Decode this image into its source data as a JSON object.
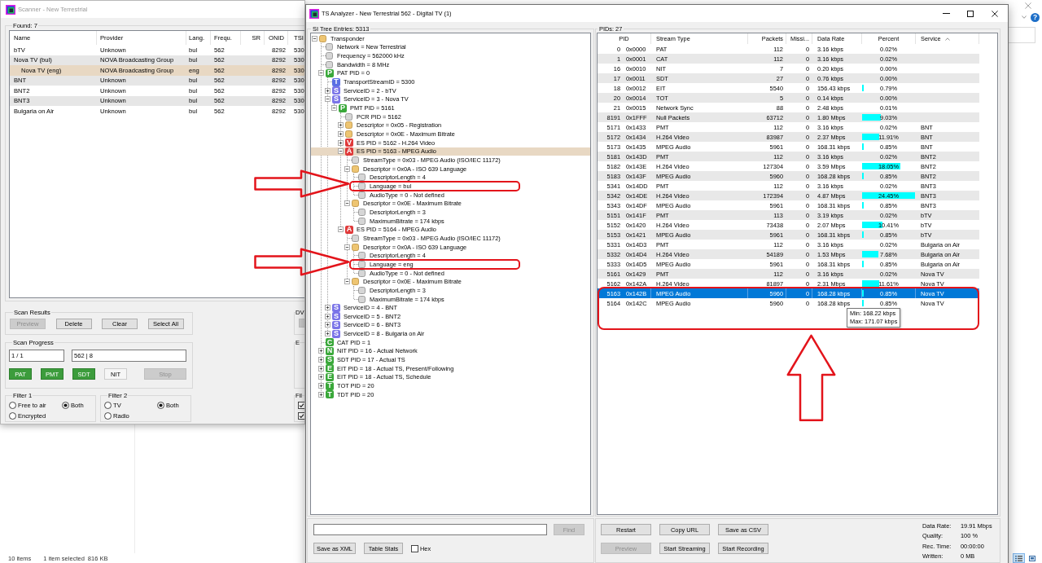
{
  "scanner": {
    "title": "Scanner - New Terrestrial",
    "list": {
      "label": "Found: 7",
      "columns": [
        "Name",
        "Provider",
        "Lang.",
        "Frequ.",
        "SR",
        "ONID",
        "TSI"
      ],
      "rows": [
        {
          "name": "bTV",
          "provider": "Unknown",
          "lang": "bul",
          "frequ": "562",
          "onid": "8292",
          "tsi": "530",
          "selected": false
        },
        {
          "name": "Nova TV (bul)",
          "provider": "NOVA Broadcasting Group",
          "lang": "bul",
          "frequ": "562",
          "onid": "8292",
          "tsi": "530",
          "selected": false,
          "children": [
            {
              "name": "Nova TV (eng)",
              "provider": "NOVA Broadcasting Group",
              "lang": "eng",
              "frequ": "562",
              "onid": "8292",
              "tsi": "530",
              "selected": true
            }
          ]
        },
        {
          "name": "BNT",
          "provider": "Unknown",
          "lang": "bul",
          "frequ": "562",
          "onid": "8292",
          "tsi": "530",
          "selected": false
        },
        {
          "name": "BNT2",
          "provider": "Unknown",
          "lang": "bul",
          "frequ": "562",
          "onid": "8292",
          "tsi": "530",
          "selected": false
        },
        {
          "name": "BNT3",
          "provider": "Unknown",
          "lang": "bul",
          "frequ": "562",
          "onid": "8292",
          "tsi": "530",
          "selected": false
        },
        {
          "name": "Bulgaria on Air",
          "provider": "Unknown",
          "lang": "bul",
          "frequ": "562",
          "onid": "8292",
          "tsi": "530",
          "selected": false
        }
      ]
    },
    "scan_results": {
      "title": "Scan Results",
      "buttons": [
        {
          "label": "Preview",
          "disabled": true
        },
        {
          "label": "Delete",
          "disabled": false
        },
        {
          "label": "Clear",
          "disabled": false
        },
        {
          "label": "Select All",
          "disabled": false
        }
      ]
    },
    "scan_progress": {
      "title": "Scan Progress",
      "fields": [
        "1 / 1",
        "562 | 8"
      ],
      "tables": [
        {
          "label": "PAT",
          "on": true
        },
        {
          "label": "PMT",
          "on": true
        },
        {
          "label": "SDT",
          "on": true
        },
        {
          "label": "NIT",
          "on": false
        }
      ],
      "stop": {
        "label": "Stop",
        "disabled": true
      }
    },
    "filters": [
      {
        "title": "Filter 1",
        "options": [
          {
            "label": "Free to air",
            "selected": false
          },
          {
            "label": "Both",
            "selected": true
          },
          {
            "label": "Encrypted",
            "selected": false
          }
        ]
      },
      {
        "title": "Filter 2",
        "options": [
          {
            "label": "TV",
            "selected": false
          },
          {
            "label": "Both",
            "selected": true
          },
          {
            "label": "Radio",
            "selected": false
          }
        ]
      }
    ],
    "side_groups": [
      {
        "title": "DV",
        "buttons": [
          {
            "disabled": true
          }
        ]
      },
      {
        "title": "E"
      },
      {
        "title": "Fil",
        "checkboxes": [
          {
            "checked": true
          },
          {
            "checked": true
          }
        ]
      }
    ]
  },
  "analyzer": {
    "title": "TS Analyzer - New Terrestrial 562 - Digital TV (1)",
    "tree": {
      "label": "SI Tree Entries: 5313",
      "nodes": [
        {
          "text": "Transponder",
          "kind": "folder",
          "expanded": true,
          "selected": false,
          "children": [
            {
              "text": "Network = New Terrestrial",
              "kind": "item",
              "selected": false
            },
            {
              "text": "Frequency = 562000 kHz",
              "kind": "item",
              "selected": false
            },
            {
              "text": "Bandwidth = 8 MHz",
              "kind": "item",
              "selected": false
            },
            {
              "text": "PAT PID = 0",
              "kind": "tag",
              "badge": "P",
              "color": "#3aa83a",
              "expanded": true,
              "selected": false,
              "children": [
                {
                  "text": "TransportStreamID = 5300",
                  "kind": "tag",
                  "badge": "T",
                  "color": "#5b6fe3",
                  "selected": false
                },
                {
                  "text": "ServiceID = 2 - bTV",
                  "kind": "tag",
                  "badge": "S",
                  "color": "#7a74e8",
                  "expanded": false,
                  "selected": false
                },
                {
                  "text": "ServiceID = 3 - Nova TV",
                  "kind": "tag",
                  "badge": "S",
                  "color": "#7a74e8",
                  "expanded": true,
                  "selected": false,
                  "children": [
                    {
                      "text": "PMT PID = 5161",
                      "kind": "tag",
                      "badge": "P",
                      "color": "#3aa83a",
                      "expanded": true,
                      "selected": false,
                      "children": [
                        {
                          "text": "PCR PID = 5162",
                          "kind": "item",
                          "selected": false
                        },
                        {
                          "text": "Descriptor = 0x05 - Registration",
                          "kind": "folder",
                          "expanded": false,
                          "selected": false
                        },
                        {
                          "text": "Descriptor = 0x0E - Maximum Bitrate",
                          "kind": "folder",
                          "expanded": false,
                          "selected": false
                        },
                        {
                          "text": "ES PID = 5162 - H.264 Video",
                          "kind": "tag",
                          "badge": "V",
                          "color": "#e03a3a",
                          "expanded": false,
                          "selected": false
                        },
                        {
                          "text": "ES PID = 5163 - MPEG Audio",
                          "kind": "tag",
                          "badge": "A",
                          "color": "#e03a3a",
                          "expanded": true,
                          "selected": true,
                          "children": [
                            {
                              "text": "StreamType = 0x03 - MPEG Audio (ISO/IEC 11172)",
                              "kind": "item",
                              "selected": false
                            },
                            {
                              "text": "Descriptor = 0x0A - ISO 639 Language",
                              "kind": "folder",
                              "expanded": true,
                              "selected": false,
                              "children": [
                                {
                                  "text": "DescriptorLength = 4",
                                  "kind": "item",
                                  "selected": false
                                },
                                {
                                  "text": "Language = bul",
                                  "kind": "item",
                                  "selected": false,
                                  "annotated": true
                                },
                                {
                                  "text": "AudioType = 0 - Not defined",
                                  "kind": "item",
                                  "selected": false
                                }
                              ]
                            },
                            {
                              "text": "Descriptor = 0x0E - Maximum Bitrate",
                              "kind": "folder",
                              "expanded": true,
                              "selected": false,
                              "children": [
                                {
                                  "text": "DescriptorLength = 3",
                                  "kind": "item",
                                  "selected": false
                                },
                                {
                                  "text": "MaximumBitrate = 174 kbps",
                                  "kind": "item",
                                  "selected": false
                                }
                              ]
                            }
                          ]
                        },
                        {
                          "text": "ES PID = 5164 - MPEG Audio",
                          "kind": "tag",
                          "badge": "A",
                          "color": "#e03a3a",
                          "expanded": true,
                          "selected": false,
                          "children": [
                            {
                              "text": "StreamType = 0x03 - MPEG Audio (ISO/IEC 11172)",
                              "kind": "item",
                              "selected": false
                            },
                            {
                              "text": "Descriptor = 0x0A - ISO 639 Language",
                              "kind": "folder",
                              "expanded": true,
                              "selected": false,
                              "children": [
                                {
                                  "text": "DescriptorLength = 4",
                                  "kind": "item",
                                  "selected": false
                                },
                                {
                                  "text": "Language = eng",
                                  "kind": "item",
                                  "selected": false,
                                  "annotated": true
                                },
                                {
                                  "text": "AudioType = 0 - Not defined",
                                  "kind": "item",
                                  "selected": false
                                }
                              ]
                            },
                            {
                              "text": "Descriptor = 0x0E - Maximum Bitrate",
                              "kind": "folder",
                              "expanded": true,
                              "selected": false,
                              "children": [
                                {
                                  "text": "DescriptorLength = 3",
                                  "kind": "item",
                                  "selected": false
                                },
                                {
                                  "text": "MaximumBitrate = 174 kbps",
                                  "kind": "item",
                                  "selected": false
                                }
                              ]
                            }
                          ]
                        }
                      ]
                    }
                  ]
                },
                {
                  "text": "ServiceID = 4 - BNT",
                  "kind": "tag",
                  "badge": "S",
                  "color": "#7a74e8",
                  "expanded": false,
                  "selected": false
                },
                {
                  "text": "ServiceID = 5 - BNT2",
                  "kind": "tag",
                  "badge": "S",
                  "color": "#7a74e8",
                  "expanded": false,
                  "selected": false
                },
                {
                  "text": "ServiceID = 6 - BNT3",
                  "kind": "tag",
                  "badge": "S",
                  "color": "#7a74e8",
                  "expanded": false,
                  "selected": false
                },
                {
                  "text": "ServiceID = 8 - Bulgaria on Air",
                  "kind": "tag",
                  "badge": "S",
                  "color": "#7a74e8",
                  "expanded": false,
                  "selected": false
                }
              ]
            },
            {
              "text": "CAT PID = 1",
              "kind": "tag",
              "badge": "C",
              "color": "#3aa83a",
              "selected": false
            },
            {
              "text": "NIT PID = 16 - Actual Network",
              "kind": "tag",
              "badge": "N",
              "color": "#3aa83a",
              "expanded": false,
              "selected": false
            },
            {
              "text": "SDT PID = 17 - Actual TS",
              "kind": "tag",
              "badge": "S",
              "color": "#3aa83a",
              "expanded": false,
              "selected": false
            },
            {
              "text": "EIT PID = 18 - Actual TS, Present/Following",
              "kind": "tag",
              "badge": "E",
              "color": "#3aa83a",
              "expanded": false,
              "selected": false
            },
            {
              "text": "EIT PID = 18 - Actual TS, Schedule",
              "kind": "tag",
              "badge": "E",
              "color": "#3aa83a",
              "expanded": false,
              "selected": false
            },
            {
              "text": "TOT PID = 20",
              "kind": "tag",
              "badge": "T",
              "color": "#3aa83a",
              "expanded": false,
              "selected": false
            },
            {
              "text": "TDT PID = 20",
              "kind": "tag",
              "badge": "T",
              "color": "#3aa83a",
              "expanded": false,
              "selected": false
            }
          ]
        }
      ]
    },
    "find": {
      "label": "Find",
      "disabled": true
    },
    "tree_buttons": [
      {
        "label": "Save as XML",
        "disabled": false
      },
      {
        "label": "Table Stats",
        "disabled": false
      }
    ],
    "hex": {
      "label": "Hex",
      "checked": false
    },
    "pid_table": {
      "label": "PIDs: 27",
      "columns": [
        {
          "label": "PID"
        },
        {
          "label": "Stream Type"
        },
        {
          "label": "Packets"
        },
        {
          "label": "Missi..."
        },
        {
          "label": "Data Rate"
        },
        {
          "label": "Percent"
        },
        {
          "label": "Service",
          "sorted": true
        }
      ],
      "rows": [
        {
          "pid": "0",
          "hex": "0x0000",
          "type": "PAT",
          "packets": "112",
          "missing": "0",
          "rate": "3.16 kbps",
          "percent": "0.02%",
          "selected": false
        },
        {
          "pid": "1",
          "hex": "0x0001",
          "type": "CAT",
          "packets": "112",
          "missing": "0",
          "rate": "3.16 kbps",
          "percent": "0.02%",
          "selected": false
        },
        {
          "pid": "16",
          "hex": "0x0010",
          "type": "NIT",
          "packets": "7",
          "missing": "0",
          "rate": "0.20 kbps",
          "percent": "0.00%",
          "selected": false
        },
        {
          "pid": "17",
          "hex": "0x0011",
          "type": "SDT",
          "packets": "27",
          "missing": "0",
          "rate": "0.76 kbps",
          "percent": "0.00%",
          "selected": false
        },
        {
          "pid": "18",
          "hex": "0x0012",
          "type": "EIT",
          "packets": "5540",
          "missing": "0",
          "rate": "156.43 kbps",
          "percent": "0.79%",
          "level": 0.03,
          "selected": false
        },
        {
          "pid": "20",
          "hex": "0x0014",
          "type": "TOT",
          "packets": "5",
          "missing": "0",
          "rate": "0.14 kbps",
          "percent": "0.00%",
          "selected": false
        },
        {
          "pid": "21",
          "hex": "0x0015",
          "type": "Network Sync",
          "packets": "88",
          "missing": "0",
          "rate": "2.48 kbps",
          "percent": "0.01%",
          "selected": false
        },
        {
          "pid": "8191",
          "hex": "0x1FFF",
          "type": "Null Packets",
          "packets": "63712",
          "missing": "0",
          "rate": "1.80 Mbps",
          "percent": "9.03%",
          "level": 0.36,
          "selected": false
        },
        {
          "pid": "5171",
          "hex": "0x1433",
          "type": "PMT",
          "packets": "112",
          "missing": "0",
          "rate": "3.16 kbps",
          "percent": "0.02%",
          "service": "BNT",
          "selected": false
        },
        {
          "pid": "5172",
          "hex": "0x1434",
          "type": "H.264 Video",
          "packets": "83987",
          "missing": "0",
          "rate": "2.37 Mbps",
          "percent": "11.91%",
          "level": 0.33,
          "service": "BNT",
          "selected": false
        },
        {
          "pid": "5173",
          "hex": "0x1435",
          "type": "MPEG Audio",
          "packets": "5961",
          "missing": "0",
          "rate": "168.31 kbps",
          "percent": "0.85%",
          "level": 0.03,
          "service": "BNT",
          "selected": false
        },
        {
          "pid": "5181",
          "hex": "0x143D",
          "type": "PMT",
          "packets": "112",
          "missing": "0",
          "rate": "3.16 kbps",
          "percent": "0.02%",
          "service": "BNT2",
          "selected": false
        },
        {
          "pid": "5182",
          "hex": "0x143E",
          "type": "H.264 Video",
          "packets": "127304",
          "missing": "0",
          "rate": "3.59 Mbps",
          "percent": "18.05%",
          "level": 0.73,
          "service": "BNT2",
          "selected": false
        },
        {
          "pid": "5183",
          "hex": "0x143F",
          "type": "MPEG Audio",
          "packets": "5960",
          "missing": "0",
          "rate": "168.28 kbps",
          "percent": "0.85%",
          "level": 0.03,
          "service": "BNT2",
          "selected": false
        },
        {
          "pid": "5341",
          "hex": "0x14DD",
          "type": "PMT",
          "packets": "112",
          "missing": "0",
          "rate": "3.16 kbps",
          "percent": "0.02%",
          "service": "BNT3",
          "selected": false
        },
        {
          "pid": "5342",
          "hex": "0x14DE",
          "type": "H.264 Video",
          "packets": "172394",
          "missing": "0",
          "rate": "4.87 Mbps",
          "percent": "24.45%",
          "level": 1,
          "service": "BNT3",
          "selected": false
        },
        {
          "pid": "5343",
          "hex": "0x14DF",
          "type": "MPEG Audio",
          "packets": "5961",
          "missing": "0",
          "rate": "168.31 kbps",
          "percent": "0.85%",
          "level": 0.03,
          "service": "BNT3",
          "selected": false
        },
        {
          "pid": "5151",
          "hex": "0x141F",
          "type": "PMT",
          "packets": "113",
          "missing": "0",
          "rate": "3.19 kbps",
          "percent": "0.02%",
          "service": "bTV",
          "selected": false
        },
        {
          "pid": "5152",
          "hex": "0x1420",
          "type": "H.264 Video",
          "packets": "73438",
          "missing": "0",
          "rate": "2.07 Mbps",
          "percent": "10.41%",
          "level": 0.39,
          "service": "bTV",
          "selected": false
        },
        {
          "pid": "5153",
          "hex": "0x1421",
          "type": "MPEG Audio",
          "packets": "5961",
          "missing": "0",
          "rate": "168.31 kbps",
          "percent": "0.85%",
          "level": 0.03,
          "service": "bTV",
          "selected": false
        },
        {
          "pid": "5331",
          "hex": "0x14D3",
          "type": "PMT",
          "packets": "112",
          "missing": "0",
          "rate": "3.16 kbps",
          "percent": "0.02%",
          "service": "Bulgaria on Air",
          "selected": false
        },
        {
          "pid": "5332",
          "hex": "0x14D4",
          "type": "H.264 Video",
          "packets": "54189",
          "missing": "0",
          "rate": "1.53 Mbps",
          "percent": "7.68%",
          "level": 0.3,
          "service": "Bulgaria on Air",
          "selected": false
        },
        {
          "pid": "5333",
          "hex": "0x14D5",
          "type": "MPEG Audio",
          "packets": "5961",
          "missing": "0",
          "rate": "168.31 kbps",
          "percent": "0.85%",
          "level": 0.03,
          "service": "Bulgaria on Air",
          "selected": false
        },
        {
          "pid": "5161",
          "hex": "0x1429",
          "type": "PMT",
          "packets": "112",
          "missing": "0",
          "rate": "3.16 kbps",
          "percent": "0.02%",
          "service": "Nova TV",
          "selected": false
        },
        {
          "pid": "5162",
          "hex": "0x142A",
          "type": "H.264 Video",
          "packets": "81897",
          "missing": "0",
          "rate": "2.31 Mbps",
          "percent": "11.61%",
          "level": 0.33,
          "service": "Nova TV",
          "selected": false
        },
        {
          "pid": "5163",
          "hex": "0x142B",
          "type": "MPEG Audio",
          "packets": "5960",
          "missing": "0",
          "rate": "168.28 kbps",
          "percent": "0.85%",
          "level": 0.03,
          "service": "Nova TV",
          "selected": true,
          "annotated": true
        },
        {
          "pid": "5164",
          "hex": "0x142C",
          "type": "MPEG Audio",
          "packets": "5960",
          "missing": "0",
          "rate": "168.28 kbps",
          "percent": "0.85%",
          "level": 0.03,
          "service": "Nova TV",
          "selected": false,
          "annotated": true
        }
      ],
      "tooltip": [
        "Min: 168.22 kbps",
        "Max: 171.07 kbps"
      ]
    },
    "stream_buttons": [
      {
        "label": "Restart",
        "disabled": false
      },
      {
        "label": "Copy URL",
        "disabled": false
      },
      {
        "label": "Save as CSV",
        "disabled": false
      },
      {
        "label": "Preview",
        "disabled": true
      },
      {
        "label": "Start Streaming",
        "disabled": false
      },
      {
        "label": "Start Recording",
        "disabled": false
      }
    ],
    "stats": [
      {
        "label": "Data Rate:",
        "value": "19.91 Mbps"
      },
      {
        "label": "Quality:",
        "value": "100 %"
      },
      {
        "label": "Rec. Time:",
        "value": "00:00:00"
      },
      {
        "label": "Written:",
        "value": "0 MB"
      }
    ]
  },
  "explorer": {
    "help": "?",
    "status": [
      "10 items",
      "1 item selected",
      "816 KB"
    ],
    "view_buttons": [
      {
        "kind": "details",
        "selected": true
      },
      {
        "kind": "tiles",
        "selected": false
      }
    ]
  }
}
